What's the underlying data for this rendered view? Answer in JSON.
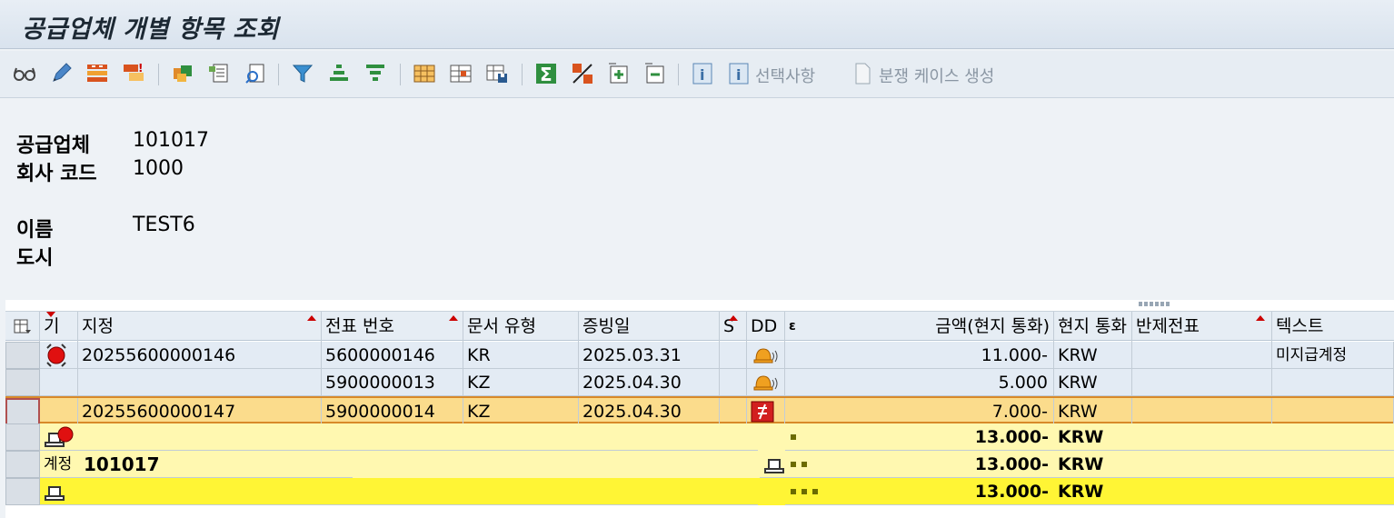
{
  "title": "공급업체 개별 항목 조회",
  "toolbar": {
    "selection_label": "선택사항",
    "dispute_label": "분쟁 케이스 생성"
  },
  "header_info": {
    "vendor_label": "공급업체",
    "vendor_value": "101017",
    "company_label": "회사 코드",
    "company_value": "1000",
    "name_label": "이름",
    "name_value": "TEST6",
    "city_label": "도시",
    "city_value": ""
  },
  "table": {
    "columns": [
      "기",
      "지정",
      "전표 번호",
      "문서 유형",
      "증빙일",
      "S",
      "DD",
      "ε",
      "금액(현지 통화)",
      "현지 통화",
      "반제전표",
      "텍스트"
    ],
    "rows": [
      {
        "status": "red",
        "assignment": "20255600000146",
        "doc_no": "5600000146",
        "doc_type": "KR",
        "date": "2025.03.31",
        "dd": "bell",
        "amount": "11.000-",
        "currency": "KRW",
        "clearing": "",
        "text": "미지급계정"
      },
      {
        "status": "",
        "assignment": "",
        "doc_no": "5900000013",
        "doc_type": "KZ",
        "date": "2025.04.30",
        "dd": "bell",
        "amount": "5.000",
        "currency": "KRW",
        "clearing": "",
        "text": ""
      },
      {
        "status": "",
        "assignment": "20255600000147",
        "doc_no": "5900000014",
        "doc_type": "KZ",
        "date": "2025.04.30",
        "dd": "red-box",
        "amount": "7.000-",
        "currency": "KRW",
        "clearing": "",
        "text": ""
      }
    ],
    "subtotal1": {
      "amount": "13.000-",
      "currency": "KRW"
    },
    "subtotal2": {
      "label": "계정",
      "account": "101017",
      "amount": "13.000-",
      "currency": "KRW"
    },
    "total": {
      "amount": "13.000-",
      "currency": "KRW"
    }
  },
  "colors": {
    "selected_row": "#fbdc8c",
    "subtotal_row": "#fff8b0",
    "total_row": "#fff535",
    "data_row": "#e3ebf4"
  }
}
